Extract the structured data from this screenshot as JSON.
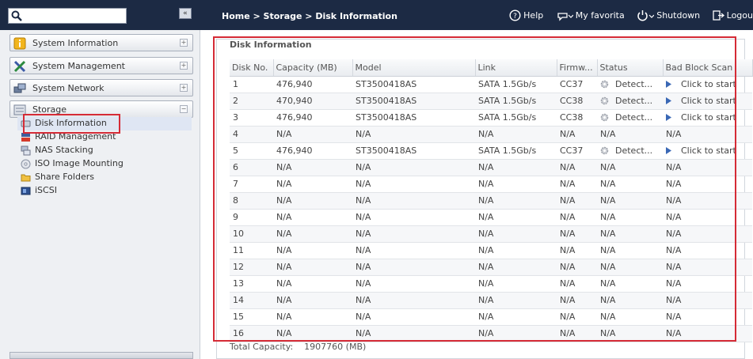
{
  "sidebar": {
    "search": {
      "placeholder": "",
      "value": ""
    },
    "collapse_label": "«",
    "categories": [
      {
        "label": "System Information",
        "icon": "info-icon"
      },
      {
        "label": "System Management",
        "icon": "tools-icon"
      },
      {
        "label": "System Network",
        "icon": "network-icon"
      },
      {
        "label": "Storage",
        "icon": "storage-icon"
      }
    ],
    "storage_items": [
      {
        "label": "Disk Information",
        "icon": "disk-icon"
      },
      {
        "label": "RAID Management",
        "icon": "raid-icon"
      },
      {
        "label": "NAS Stacking",
        "icon": "stacking-icon"
      },
      {
        "label": "ISO Image Mounting",
        "icon": "iso-icon"
      },
      {
        "label": "Share Folders",
        "icon": "folder-icon"
      },
      {
        "label": "iSCSI",
        "icon": "iscsi-icon"
      }
    ]
  },
  "header": {
    "breadcrumb": "Home > Storage > Disk Information",
    "tools": {
      "help": "Help",
      "favorite": "My favorita",
      "shutdown": "Shutdown",
      "logout": "Logou"
    }
  },
  "main": {
    "panel_title": "Disk Information",
    "columns": [
      "Disk No.",
      "Capacity (MB)",
      "Model",
      "Link",
      "Firmw...",
      "Status",
      "Bad Block Scan"
    ],
    "rows": [
      {
        "no": "1",
        "capacity": "476,940",
        "model": "ST3500418AS",
        "link": "SATA 1.5Gb/s",
        "firmware": "CC37",
        "status": "Detect...",
        "scan": "Click to start",
        "has_icons": true
      },
      {
        "no": "2",
        "capacity": "470,940",
        "model": "ST3500418AS",
        "link": "SATA 1.5Gb/s",
        "firmware": "CC38",
        "status": "Detect...",
        "scan": "Click to start",
        "has_icons": true
      },
      {
        "no": "3",
        "capacity": "476,940",
        "model": "ST3500418AS",
        "link": "SATA 1.5Gb/s",
        "firmware": "CC38",
        "status": "Detect...",
        "scan": "Click to start",
        "has_icons": true
      },
      {
        "no": "4",
        "capacity": "N/A",
        "model": "N/A",
        "link": "N/A",
        "firmware": "N/A",
        "status": "N/A",
        "scan": "N/A",
        "has_icons": false
      },
      {
        "no": "5",
        "capacity": "476,940",
        "model": "ST3500418AS",
        "link": "SATA 1.5Gb/s",
        "firmware": "CC37",
        "status": "Detect...",
        "scan": "Click to start",
        "has_icons": true
      },
      {
        "no": "6",
        "capacity": "N/A",
        "model": "N/A",
        "link": "N/A",
        "firmware": "N/A",
        "status": "N/A",
        "scan": "N/A",
        "has_icons": false
      },
      {
        "no": "7",
        "capacity": "N/A",
        "model": "N/A",
        "link": "N/A",
        "firmware": "N/A",
        "status": "N/A",
        "scan": "N/A",
        "has_icons": false
      },
      {
        "no": "8",
        "capacity": "N/A",
        "model": "N/A",
        "link": "N/A",
        "firmware": "N/A",
        "status": "N/A",
        "scan": "N/A",
        "has_icons": false
      },
      {
        "no": "9",
        "capacity": "N/A",
        "model": "N/A",
        "link": "N/A",
        "firmware": "N/A",
        "status": "N/A",
        "scan": "N/A",
        "has_icons": false
      },
      {
        "no": "10",
        "capacity": "N/A",
        "model": "N/A",
        "link": "N/A",
        "firmware": "N/A",
        "status": "N/A",
        "scan": "N/A",
        "has_icons": false
      },
      {
        "no": "11",
        "capacity": "N/A",
        "model": "N/A",
        "link": "N/A",
        "firmware": "N/A",
        "status": "N/A",
        "scan": "N/A",
        "has_icons": false
      },
      {
        "no": "12",
        "capacity": "N/A",
        "model": "N/A",
        "link": "N/A",
        "firmware": "N/A",
        "status": "N/A",
        "scan": "N/A",
        "has_icons": false
      },
      {
        "no": "13",
        "capacity": "N/A",
        "model": "N/A",
        "link": "N/A",
        "firmware": "N/A",
        "status": "N/A",
        "scan": "N/A",
        "has_icons": false
      },
      {
        "no": "14",
        "capacity": "N/A",
        "model": "N/A",
        "link": "N/A",
        "firmware": "N/A",
        "status": "N/A",
        "scan": "N/A",
        "has_icons": false
      },
      {
        "no": "15",
        "capacity": "N/A",
        "model": "N/A",
        "link": "N/A",
        "firmware": "N/A",
        "status": "N/A",
        "scan": "N/A",
        "has_icons": false
      },
      {
        "no": "16",
        "capacity": "N/A",
        "model": "N/A",
        "link": "N/A",
        "firmware": "N/A",
        "status": "N/A",
        "scan": "N/A",
        "has_icons": false
      }
    ],
    "total_label": "Total Capacity:",
    "total_value": "1907760 (MB)"
  },
  "colors": {
    "header_bg": "#1c2a44",
    "highlight": "#d52b36",
    "sidebar_bg": "#eef0f3"
  }
}
